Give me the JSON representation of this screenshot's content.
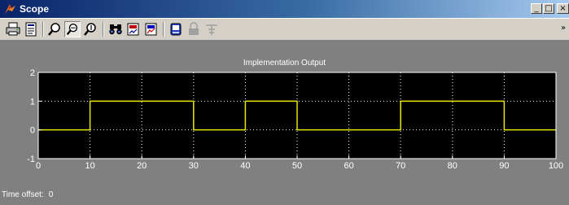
{
  "window": {
    "title": "Scope",
    "controls": {
      "minimize": "_",
      "maximize": "□",
      "close": "×"
    }
  },
  "toolbar": {
    "buttons": [
      {
        "name": "print-icon",
        "tooltip": ""
      },
      {
        "name": "parameters-icon",
        "tooltip": ""
      },
      {
        "name": "zoom-icon",
        "tooltip": ""
      },
      {
        "name": "zoom-x-icon",
        "tooltip": ""
      },
      {
        "name": "zoom-y-icon",
        "tooltip": ""
      },
      {
        "name": "autoscale-icon",
        "tooltip": ""
      },
      {
        "name": "save-axes-icon",
        "tooltip": ""
      },
      {
        "name": "restore-axes-icon",
        "tooltip": ""
      },
      {
        "name": "floating-scope-icon",
        "tooltip": ""
      },
      {
        "name": "lock-icon",
        "tooltip": ""
      },
      {
        "name": "signal-selection-icon",
        "tooltip": ""
      }
    ],
    "overflow": "»"
  },
  "status": {
    "time_offset_label": "Time offset:",
    "time_offset_value": "0"
  },
  "colors": {
    "signal": "#e6e600",
    "axes_bg": "#000000",
    "figure_bg": "#808080",
    "grid": "#ffffff",
    "text": "#ffffff"
  },
  "chart_data": {
    "type": "line",
    "title": "Implementation Output",
    "xlabel": "",
    "ylabel": "",
    "xlim": [
      0,
      100
    ],
    "ylim": [
      -1,
      2
    ],
    "xticks": [
      0,
      10,
      20,
      30,
      40,
      50,
      60,
      70,
      80,
      90,
      100
    ],
    "yticks": [
      -1,
      0,
      1,
      2
    ],
    "grid": true,
    "step": true,
    "series": [
      {
        "x": [
          0,
          10,
          10,
          30,
          30,
          40,
          40,
          50,
          50,
          70,
          70,
          90,
          90,
          100
        ],
        "y": [
          0,
          0,
          1,
          1,
          0,
          0,
          1,
          1,
          0,
          0,
          1,
          1,
          0,
          0
        ]
      }
    ]
  }
}
